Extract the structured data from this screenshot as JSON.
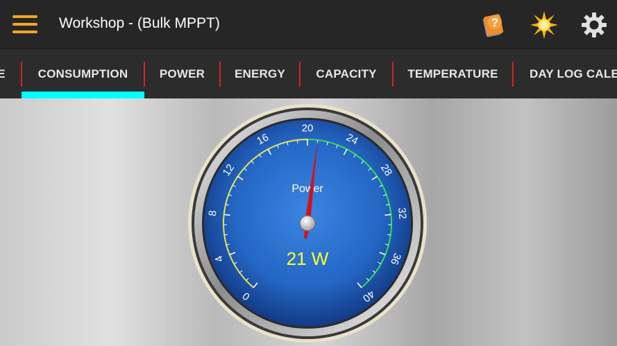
{
  "app": {
    "title": "Workshop - (Bulk MPPT)"
  },
  "icons": {
    "menu": "hamburger-menu-icon",
    "help": "help-book-icon",
    "brightness": "sun-icon",
    "settings": "gear-icon"
  },
  "tabs": [
    {
      "label": "E"
    },
    {
      "label": "CONSUMPTION",
      "selected": true
    },
    {
      "label": "POWER"
    },
    {
      "label": "ENERGY"
    },
    {
      "label": "CAPACITY"
    },
    {
      "label": "TEMPERATURE"
    },
    {
      "label": "DAY LOG CALEN"
    }
  ],
  "gauge": {
    "label": "Power",
    "readout": "21 W",
    "value": 21,
    "min": 0,
    "max": 40,
    "ticks": [
      "0",
      "4",
      "8",
      "12",
      "16",
      "20",
      "24",
      "28",
      "32",
      "36",
      "40"
    ],
    "low_zone_color": "#e6e64a",
    "high_zone_color": "#2ee05a",
    "zone_split": 20,
    "needle_color": "#d6101a",
    "readout_color": "#ffff33"
  },
  "colors": {
    "accent": "#00ffff",
    "tab_separator": "#d8222a",
    "menu_icon": "#f5a623"
  }
}
